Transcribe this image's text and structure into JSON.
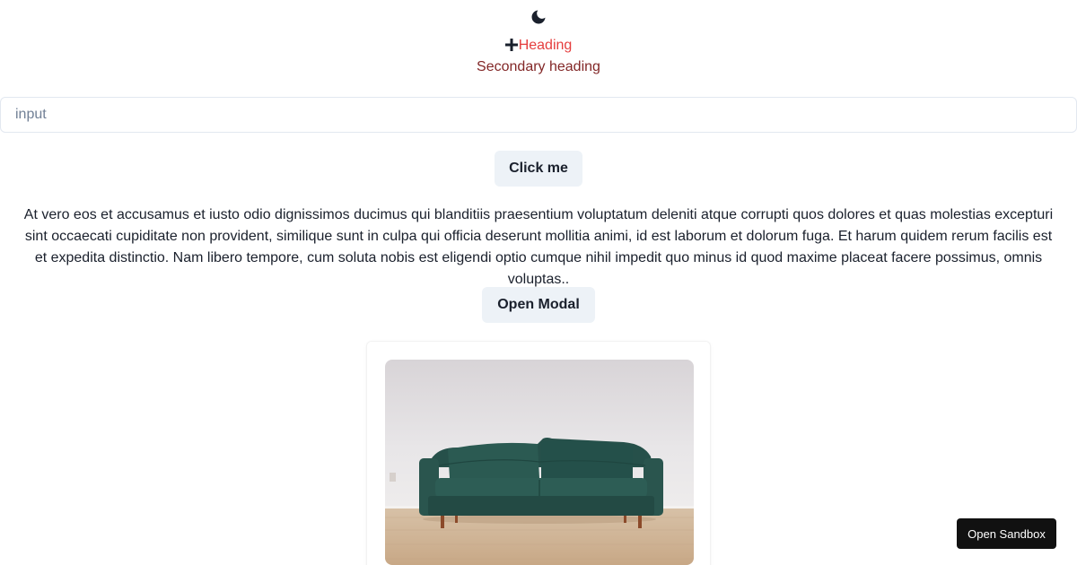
{
  "header": {
    "theme_toggle_icon": "moon-icon",
    "heading_icon": "plus-icon",
    "heading": "Heading",
    "secondary_heading": "Secondary heading",
    "colors": {
      "heading": "#e53e3e",
      "secondary_heading": "#822727"
    }
  },
  "form": {
    "input_placeholder": "input",
    "input_value": "",
    "click_button_label": "Click me"
  },
  "content": {
    "paragraph": "At vero eos et accusamus et iusto odio dignissimos ducimus qui blanditiis praesentium voluptatum deleniti atque corrupti quos dolores et quas molestias excepturi sint occaecati cupiditate non provident, similique sunt in culpa qui officia deserunt mollitia animi, id est laborum et dolorum fuga. Et harum quidem rerum facilis est et expedita distinctio. Nam libero tempore, cum soluta nobis est eligendi optio cumque nihil impedit quo minus id quod maxime placeat facere possimus, omnis voluptas..",
    "modal_button_label": "Open Modal"
  },
  "card": {
    "image_subject": "green-velvet-sofa"
  },
  "sandbox": {
    "button_label": "Open Sandbox"
  }
}
